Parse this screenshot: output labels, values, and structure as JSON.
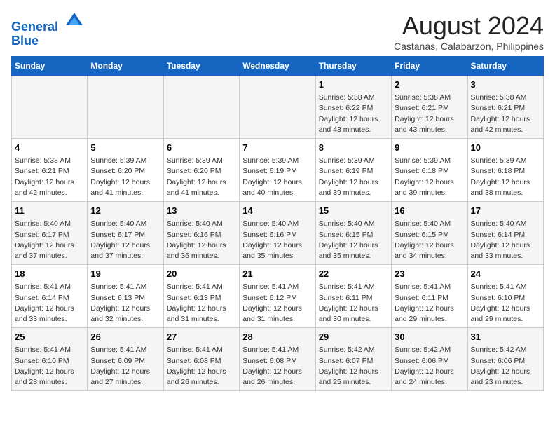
{
  "header": {
    "logo_line1": "General",
    "logo_line2": "Blue",
    "month_year": "August 2024",
    "location": "Castanas, Calabarzon, Philippines"
  },
  "weekdays": [
    "Sunday",
    "Monday",
    "Tuesday",
    "Wednesday",
    "Thursday",
    "Friday",
    "Saturday"
  ],
  "weeks": [
    [
      {
        "day": "",
        "info": ""
      },
      {
        "day": "",
        "info": ""
      },
      {
        "day": "",
        "info": ""
      },
      {
        "day": "",
        "info": ""
      },
      {
        "day": "1",
        "info": "Sunrise: 5:38 AM\nSunset: 6:22 PM\nDaylight: 12 hours\nand 43 minutes."
      },
      {
        "day": "2",
        "info": "Sunrise: 5:38 AM\nSunset: 6:21 PM\nDaylight: 12 hours\nand 43 minutes."
      },
      {
        "day": "3",
        "info": "Sunrise: 5:38 AM\nSunset: 6:21 PM\nDaylight: 12 hours\nand 42 minutes."
      }
    ],
    [
      {
        "day": "4",
        "info": "Sunrise: 5:38 AM\nSunset: 6:21 PM\nDaylight: 12 hours\nand 42 minutes."
      },
      {
        "day": "5",
        "info": "Sunrise: 5:39 AM\nSunset: 6:20 PM\nDaylight: 12 hours\nand 41 minutes."
      },
      {
        "day": "6",
        "info": "Sunrise: 5:39 AM\nSunset: 6:20 PM\nDaylight: 12 hours\nand 41 minutes."
      },
      {
        "day": "7",
        "info": "Sunrise: 5:39 AM\nSunset: 6:19 PM\nDaylight: 12 hours\nand 40 minutes."
      },
      {
        "day": "8",
        "info": "Sunrise: 5:39 AM\nSunset: 6:19 PM\nDaylight: 12 hours\nand 39 minutes."
      },
      {
        "day": "9",
        "info": "Sunrise: 5:39 AM\nSunset: 6:18 PM\nDaylight: 12 hours\nand 39 minutes."
      },
      {
        "day": "10",
        "info": "Sunrise: 5:39 AM\nSunset: 6:18 PM\nDaylight: 12 hours\nand 38 minutes."
      }
    ],
    [
      {
        "day": "11",
        "info": "Sunrise: 5:40 AM\nSunset: 6:17 PM\nDaylight: 12 hours\nand 37 minutes."
      },
      {
        "day": "12",
        "info": "Sunrise: 5:40 AM\nSunset: 6:17 PM\nDaylight: 12 hours\nand 37 minutes."
      },
      {
        "day": "13",
        "info": "Sunrise: 5:40 AM\nSunset: 6:16 PM\nDaylight: 12 hours\nand 36 minutes."
      },
      {
        "day": "14",
        "info": "Sunrise: 5:40 AM\nSunset: 6:16 PM\nDaylight: 12 hours\nand 35 minutes."
      },
      {
        "day": "15",
        "info": "Sunrise: 5:40 AM\nSunset: 6:15 PM\nDaylight: 12 hours\nand 35 minutes."
      },
      {
        "day": "16",
        "info": "Sunrise: 5:40 AM\nSunset: 6:15 PM\nDaylight: 12 hours\nand 34 minutes."
      },
      {
        "day": "17",
        "info": "Sunrise: 5:40 AM\nSunset: 6:14 PM\nDaylight: 12 hours\nand 33 minutes."
      }
    ],
    [
      {
        "day": "18",
        "info": "Sunrise: 5:41 AM\nSunset: 6:14 PM\nDaylight: 12 hours\nand 33 minutes."
      },
      {
        "day": "19",
        "info": "Sunrise: 5:41 AM\nSunset: 6:13 PM\nDaylight: 12 hours\nand 32 minutes."
      },
      {
        "day": "20",
        "info": "Sunrise: 5:41 AM\nSunset: 6:13 PM\nDaylight: 12 hours\nand 31 minutes."
      },
      {
        "day": "21",
        "info": "Sunrise: 5:41 AM\nSunset: 6:12 PM\nDaylight: 12 hours\nand 31 minutes."
      },
      {
        "day": "22",
        "info": "Sunrise: 5:41 AM\nSunset: 6:11 PM\nDaylight: 12 hours\nand 30 minutes."
      },
      {
        "day": "23",
        "info": "Sunrise: 5:41 AM\nSunset: 6:11 PM\nDaylight: 12 hours\nand 29 minutes."
      },
      {
        "day": "24",
        "info": "Sunrise: 5:41 AM\nSunset: 6:10 PM\nDaylight: 12 hours\nand 29 minutes."
      }
    ],
    [
      {
        "day": "25",
        "info": "Sunrise: 5:41 AM\nSunset: 6:10 PM\nDaylight: 12 hours\nand 28 minutes."
      },
      {
        "day": "26",
        "info": "Sunrise: 5:41 AM\nSunset: 6:09 PM\nDaylight: 12 hours\nand 27 minutes."
      },
      {
        "day": "27",
        "info": "Sunrise: 5:41 AM\nSunset: 6:08 PM\nDaylight: 12 hours\nand 26 minutes."
      },
      {
        "day": "28",
        "info": "Sunrise: 5:41 AM\nSunset: 6:08 PM\nDaylight: 12 hours\nand 26 minutes."
      },
      {
        "day": "29",
        "info": "Sunrise: 5:42 AM\nSunset: 6:07 PM\nDaylight: 12 hours\nand 25 minutes."
      },
      {
        "day": "30",
        "info": "Sunrise: 5:42 AM\nSunset: 6:06 PM\nDaylight: 12 hours\nand 24 minutes."
      },
      {
        "day": "31",
        "info": "Sunrise: 5:42 AM\nSunset: 6:06 PM\nDaylight: 12 hours\nand 23 minutes."
      }
    ]
  ]
}
